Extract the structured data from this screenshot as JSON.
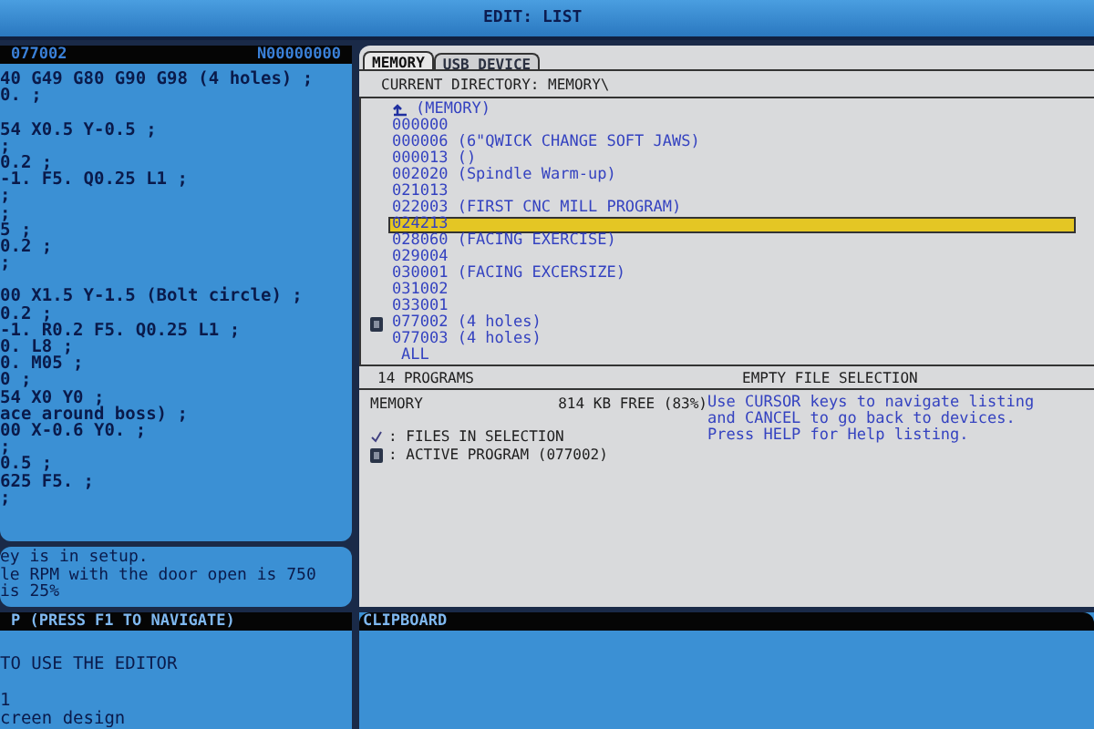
{
  "title": "EDIT: LIST",
  "program_panel": {
    "program": "077002",
    "sequence": "N00000000",
    "blocks": [
      [
        "40 G49 G80 G90 G98 (4 holes) ;",
        "0. ;"
      ],
      [
        "54 X0.5 Y-0.5 ;",
        ";",
        "0.2 ;",
        "-1. F5. Q0.25 L1 ;",
        ";",
        ";",
        "5 ;",
        "0.2 ;",
        ";"
      ],
      [
        "00 X1.5 Y-1.5 (Bolt circle) ;",
        "0.2 ;",
        "-1. R0.2 F5. Q0.25 L1 ;",
        "0. L8 ;",
        "0. M05 ;",
        "0 ;",
        "54 X0 Y0 ;",
        "ace around boss) ;",
        "00 X-0.6 Y0. ;",
        ";",
        "0.5 ;",
        "625 F5. ;",
        ";"
      ]
    ]
  },
  "messages": [
    "ey is in setup.",
    "le RPM with the door open is 750",
    "is 25%"
  ],
  "help": {
    "title": "P (PRESS F1 TO NAVIGATE)",
    "blocks": [
      [
        "TO USE THE EDITOR"
      ],
      [
        "1",
        "creen design"
      ]
    ]
  },
  "tabs": [
    {
      "label": "MEMORY",
      "selected": true
    },
    {
      "label": "USB DEVICE",
      "selected": false
    }
  ],
  "current_directory": "CURRENT DIRECTORY: MEMORY\\",
  "files": [
    {
      "kind": "parent",
      "label": "(MEMORY)",
      "selected": false,
      "active": false
    },
    {
      "kind": "file",
      "label": "000000",
      "selected": false,
      "active": false
    },
    {
      "kind": "file",
      "label": "000006 (6\"QWICK CHANGE SOFT JAWS)",
      "selected": false,
      "active": false
    },
    {
      "kind": "file",
      "label": "000013 ()",
      "selected": false,
      "active": false
    },
    {
      "kind": "file",
      "label": "002020 (Spindle Warm-up)",
      "selected": false,
      "active": false
    },
    {
      "kind": "file",
      "label": "021013",
      "selected": false,
      "active": false
    },
    {
      "kind": "file",
      "label": "022003 (FIRST CNC MILL PROGRAM)",
      "selected": false,
      "active": false
    },
    {
      "kind": "file",
      "label": "024213",
      "selected": true,
      "active": false
    },
    {
      "kind": "file",
      "label": "028060 (FACING EXERCISE)",
      "selected": false,
      "active": false
    },
    {
      "kind": "file",
      "label": "029004",
      "selected": false,
      "active": false
    },
    {
      "kind": "file",
      "label": "030001 (FACING EXCERSIZE)",
      "selected": false,
      "active": false
    },
    {
      "kind": "file",
      "label": "031002",
      "selected": false,
      "active": false
    },
    {
      "kind": "file",
      "label": "033001",
      "selected": false,
      "active": false
    },
    {
      "kind": "file",
      "label": "077002 (4 holes)",
      "selected": false,
      "active": true
    },
    {
      "kind": "file",
      "label": "077003 (4 holes)",
      "selected": false,
      "active": false
    },
    {
      "kind": "all",
      "label": "ALL",
      "selected": false,
      "active": false
    }
  ],
  "status": {
    "count": "14  PROGRAMS",
    "selection": "EMPTY FILE SELECTION"
  },
  "memory": {
    "label": "MEMORY",
    "free": "814 KB FREE (83%)"
  },
  "legend": [
    {
      "kind": "check",
      "text": ": FILES IN SELECTION"
    },
    {
      "kind": "active",
      "text": ": ACTIVE PROGRAM (077002)"
    }
  ],
  "instructions": [
    "Use CURSOR keys to navigate listing",
    "and CANCEL to go back to devices.",
    "Press HELP for Help listing."
  ],
  "clipboard": {
    "title": "CLIPBOARD"
  }
}
